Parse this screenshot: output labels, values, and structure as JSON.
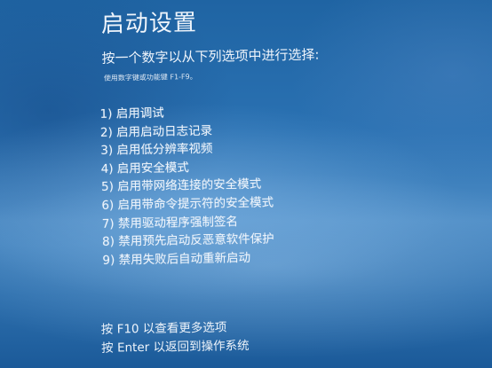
{
  "screen": {
    "title": "启动设置",
    "instruction": "按一个数字以从下列选项中进行选择:",
    "hint": "使用数字键或功能键 F1-F9。"
  },
  "options": [
    {
      "label": "1) 启用调试"
    },
    {
      "label": "2) 启用启动日志记录"
    },
    {
      "label": "3) 启用低分辨率视频"
    },
    {
      "label": "4) 启用安全模式"
    },
    {
      "label": "5) 启用带网络连接的安全模式"
    },
    {
      "label": "6) 启用带命令提示符的安全模式"
    },
    {
      "label": "7) 禁用驱动程序强制签名"
    },
    {
      "label": "8) 禁用预先启动反恶意软件保护"
    },
    {
      "label": "9) 禁用失败后自动重新启动"
    }
  ],
  "footer": {
    "more_options": "按 F10 以查看更多选项",
    "return": "按 Enter 以返回到操作系统"
  },
  "colors": {
    "background": "#2a6fae",
    "text": "#eef4fb"
  }
}
